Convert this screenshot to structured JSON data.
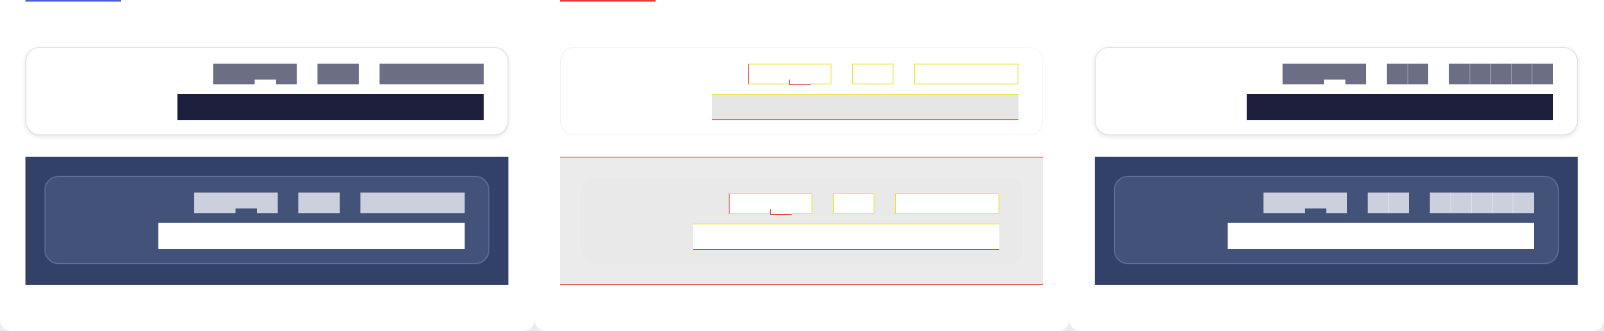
{
  "panels": [
    {
      "id": "panel-default",
      "indicator_color": "#4f5dd6"
    },
    {
      "id": "panel-debug",
      "indicator_color": "#e53935"
    },
    {
      "id": "panel-segmented",
      "indicator_color": ""
    }
  ],
  "colors": {
    "band_dark": "#324168",
    "inner_card": "#425279",
    "field_dark": "#1c1f3c",
    "label_dark": "#6b6e85",
    "label_pale": "#ccd0dd",
    "debug_outline_yellow": "#f0e32c",
    "debug_outline_red": "#e53935"
  },
  "icons": [
    "label-placeholder-block",
    "input-field-placeholder"
  ]
}
